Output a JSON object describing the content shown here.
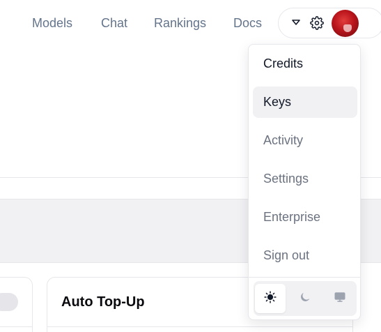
{
  "nav": {
    "links": [
      "Models",
      "Chat",
      "Rankings",
      "Docs"
    ]
  },
  "account": {
    "chevron_icon": "chevron-down-icon",
    "settings_icon": "gear-icon",
    "avatar": "user-avatar"
  },
  "menu": {
    "items": [
      {
        "label": "Credits",
        "state": "active"
      },
      {
        "label": "Keys",
        "state": "hover"
      },
      {
        "label": "Activity",
        "state": "default"
      },
      {
        "label": "Settings",
        "state": "default"
      },
      {
        "label": "Enterprise",
        "state": "default"
      },
      {
        "label": "Sign out",
        "state": "default"
      }
    ],
    "theme_options": [
      {
        "icon": "sun-icon",
        "selected": true
      },
      {
        "icon": "moon-icon",
        "selected": false
      },
      {
        "icon": "monitor-icon",
        "selected": false
      }
    ]
  },
  "content": {
    "auto_topup_title": "Auto Top-Up"
  },
  "colors": {
    "muted_text": "#64748b",
    "menu_hover_bg": "#f1f1f3",
    "border": "#e5e7eb",
    "avatar_red": "#b9151b"
  }
}
